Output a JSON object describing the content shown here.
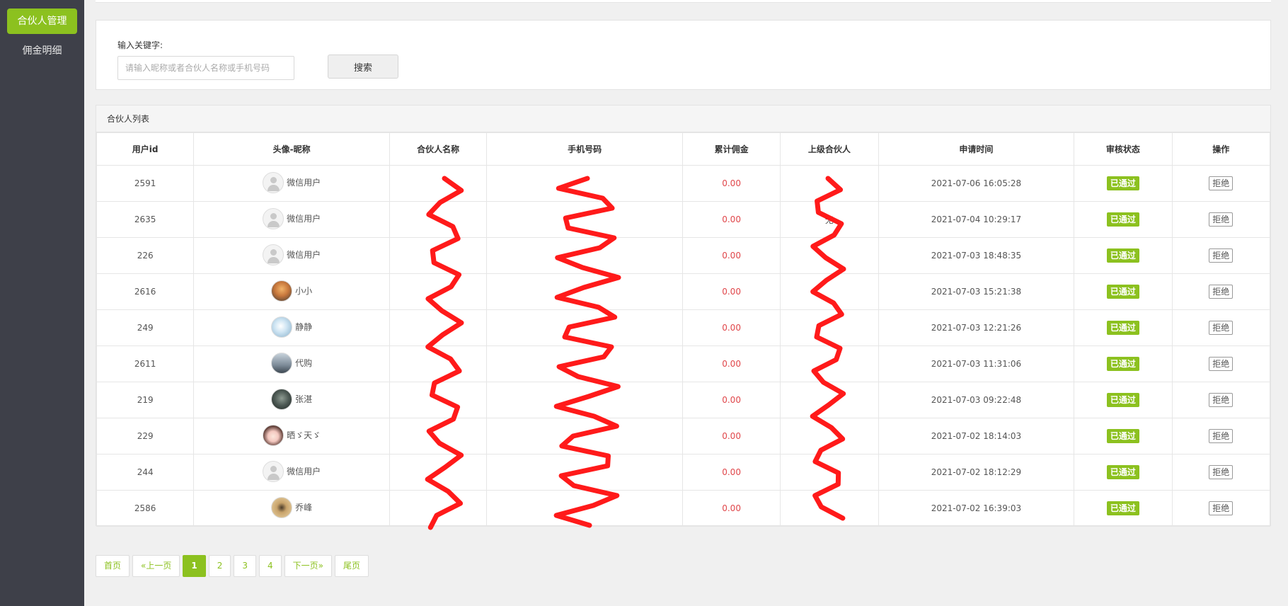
{
  "sidebar": {
    "items": [
      {
        "label": "合伙人管理",
        "active": true
      },
      {
        "label": "佣金明细",
        "active": false
      }
    ]
  },
  "search": {
    "label": "输入关键字:",
    "placeholder": "请输入昵称或者合伙人名称或手机号码",
    "value": "",
    "button_label": "搜索"
  },
  "list": {
    "title": "合伙人列表",
    "columns": [
      "用户id",
      "头像-昵称",
      "合伙人名称",
      "手机号码",
      "累计佣金",
      "上级合伙人",
      "申请时间",
      "审核状态",
      "操作"
    ],
    "rows": [
      {
        "id": "2591",
        "avatar": "default",
        "nickname": "微信用户",
        "partner_name": "",
        "phone": "",
        "commission": "0.00",
        "superior": "",
        "apply_time": "2021-07-06 16:05:28",
        "status": "已通过",
        "action": "拒绝"
      },
      {
        "id": "2635",
        "avatar": "default",
        "nickname": "微信用户",
        "partner_name": "",
        "phone": "",
        "commission": "0.00",
        "superior": "无",
        "apply_time": "2021-07-04 10:29:17",
        "status": "已通过",
        "action": "拒绝"
      },
      {
        "id": "226",
        "avatar": "default",
        "nickname": "微信用户",
        "partner_name": "",
        "phone": "",
        "commission": "0.00",
        "superior": "",
        "apply_time": "2021-07-03 18:48:35",
        "status": "已通过",
        "action": "拒绝"
      },
      {
        "id": "2616",
        "avatar": "sunset",
        "nickname": "小小",
        "partner_name": "",
        "phone": "",
        "commission": "0.00",
        "superior": "",
        "apply_time": "2021-07-03 15:21:38",
        "status": "已通过",
        "action": "拒绝"
      },
      {
        "id": "249",
        "avatar": "light-blue",
        "nickname": "静静",
        "partner_name": "",
        "phone": "",
        "commission": "0.00",
        "superior": "",
        "apply_time": "2021-07-03 12:21:26",
        "status": "已通过",
        "action": "拒绝"
      },
      {
        "id": "2611",
        "avatar": "grey-blue",
        "nickname": "代购",
        "partner_name": "",
        "phone": "",
        "commission": "0.00",
        "superior": "",
        "apply_time": "2021-07-03 11:31:06",
        "status": "已通过",
        "action": "拒绝"
      },
      {
        "id": "219",
        "avatar": "dark",
        "nickname": "张湛",
        "partner_name": "",
        "phone": "",
        "commission": "0.00",
        "superior": "",
        "apply_time": "2021-07-03 09:22:48",
        "status": "已通过",
        "action": "拒绝"
      },
      {
        "id": "229",
        "avatar": "girl",
        "nickname": "晒ゞ天ゞ",
        "partner_name": "",
        "phone": "",
        "commission": "0.00",
        "superior": "",
        "apply_time": "2021-07-02 18:14:03",
        "status": "已通过",
        "action": "拒绝"
      },
      {
        "id": "244",
        "avatar": "default",
        "nickname": "微信用户",
        "partner_name": "",
        "phone": "",
        "commission": "0.00",
        "superior": "",
        "apply_time": "2021-07-02 18:12:29",
        "status": "已通过",
        "action": "拒绝"
      },
      {
        "id": "2586",
        "avatar": "tan",
        "nickname": "乔峰",
        "partner_name": "",
        "phone": "",
        "commission": "0.00",
        "superior": "",
        "apply_time": "2021-07-02 16:39:03",
        "status": "已通过",
        "action": "拒绝"
      }
    ]
  },
  "pagination": {
    "items": [
      {
        "label": "首页",
        "current": false
      },
      {
        "label": "«上一页",
        "current": false
      },
      {
        "label": "1",
        "current": true
      },
      {
        "label": "2",
        "current": false
      },
      {
        "label": "3",
        "current": false
      },
      {
        "label": "4",
        "current": false
      },
      {
        "label": "下一页»",
        "current": false
      },
      {
        "label": "尾页",
        "current": false
      }
    ]
  },
  "colors": {
    "accent": "#8cc11f",
    "sidebar_bg": "#3e4049",
    "commission": "#e0464a",
    "redaction": "#ff1a1a"
  }
}
